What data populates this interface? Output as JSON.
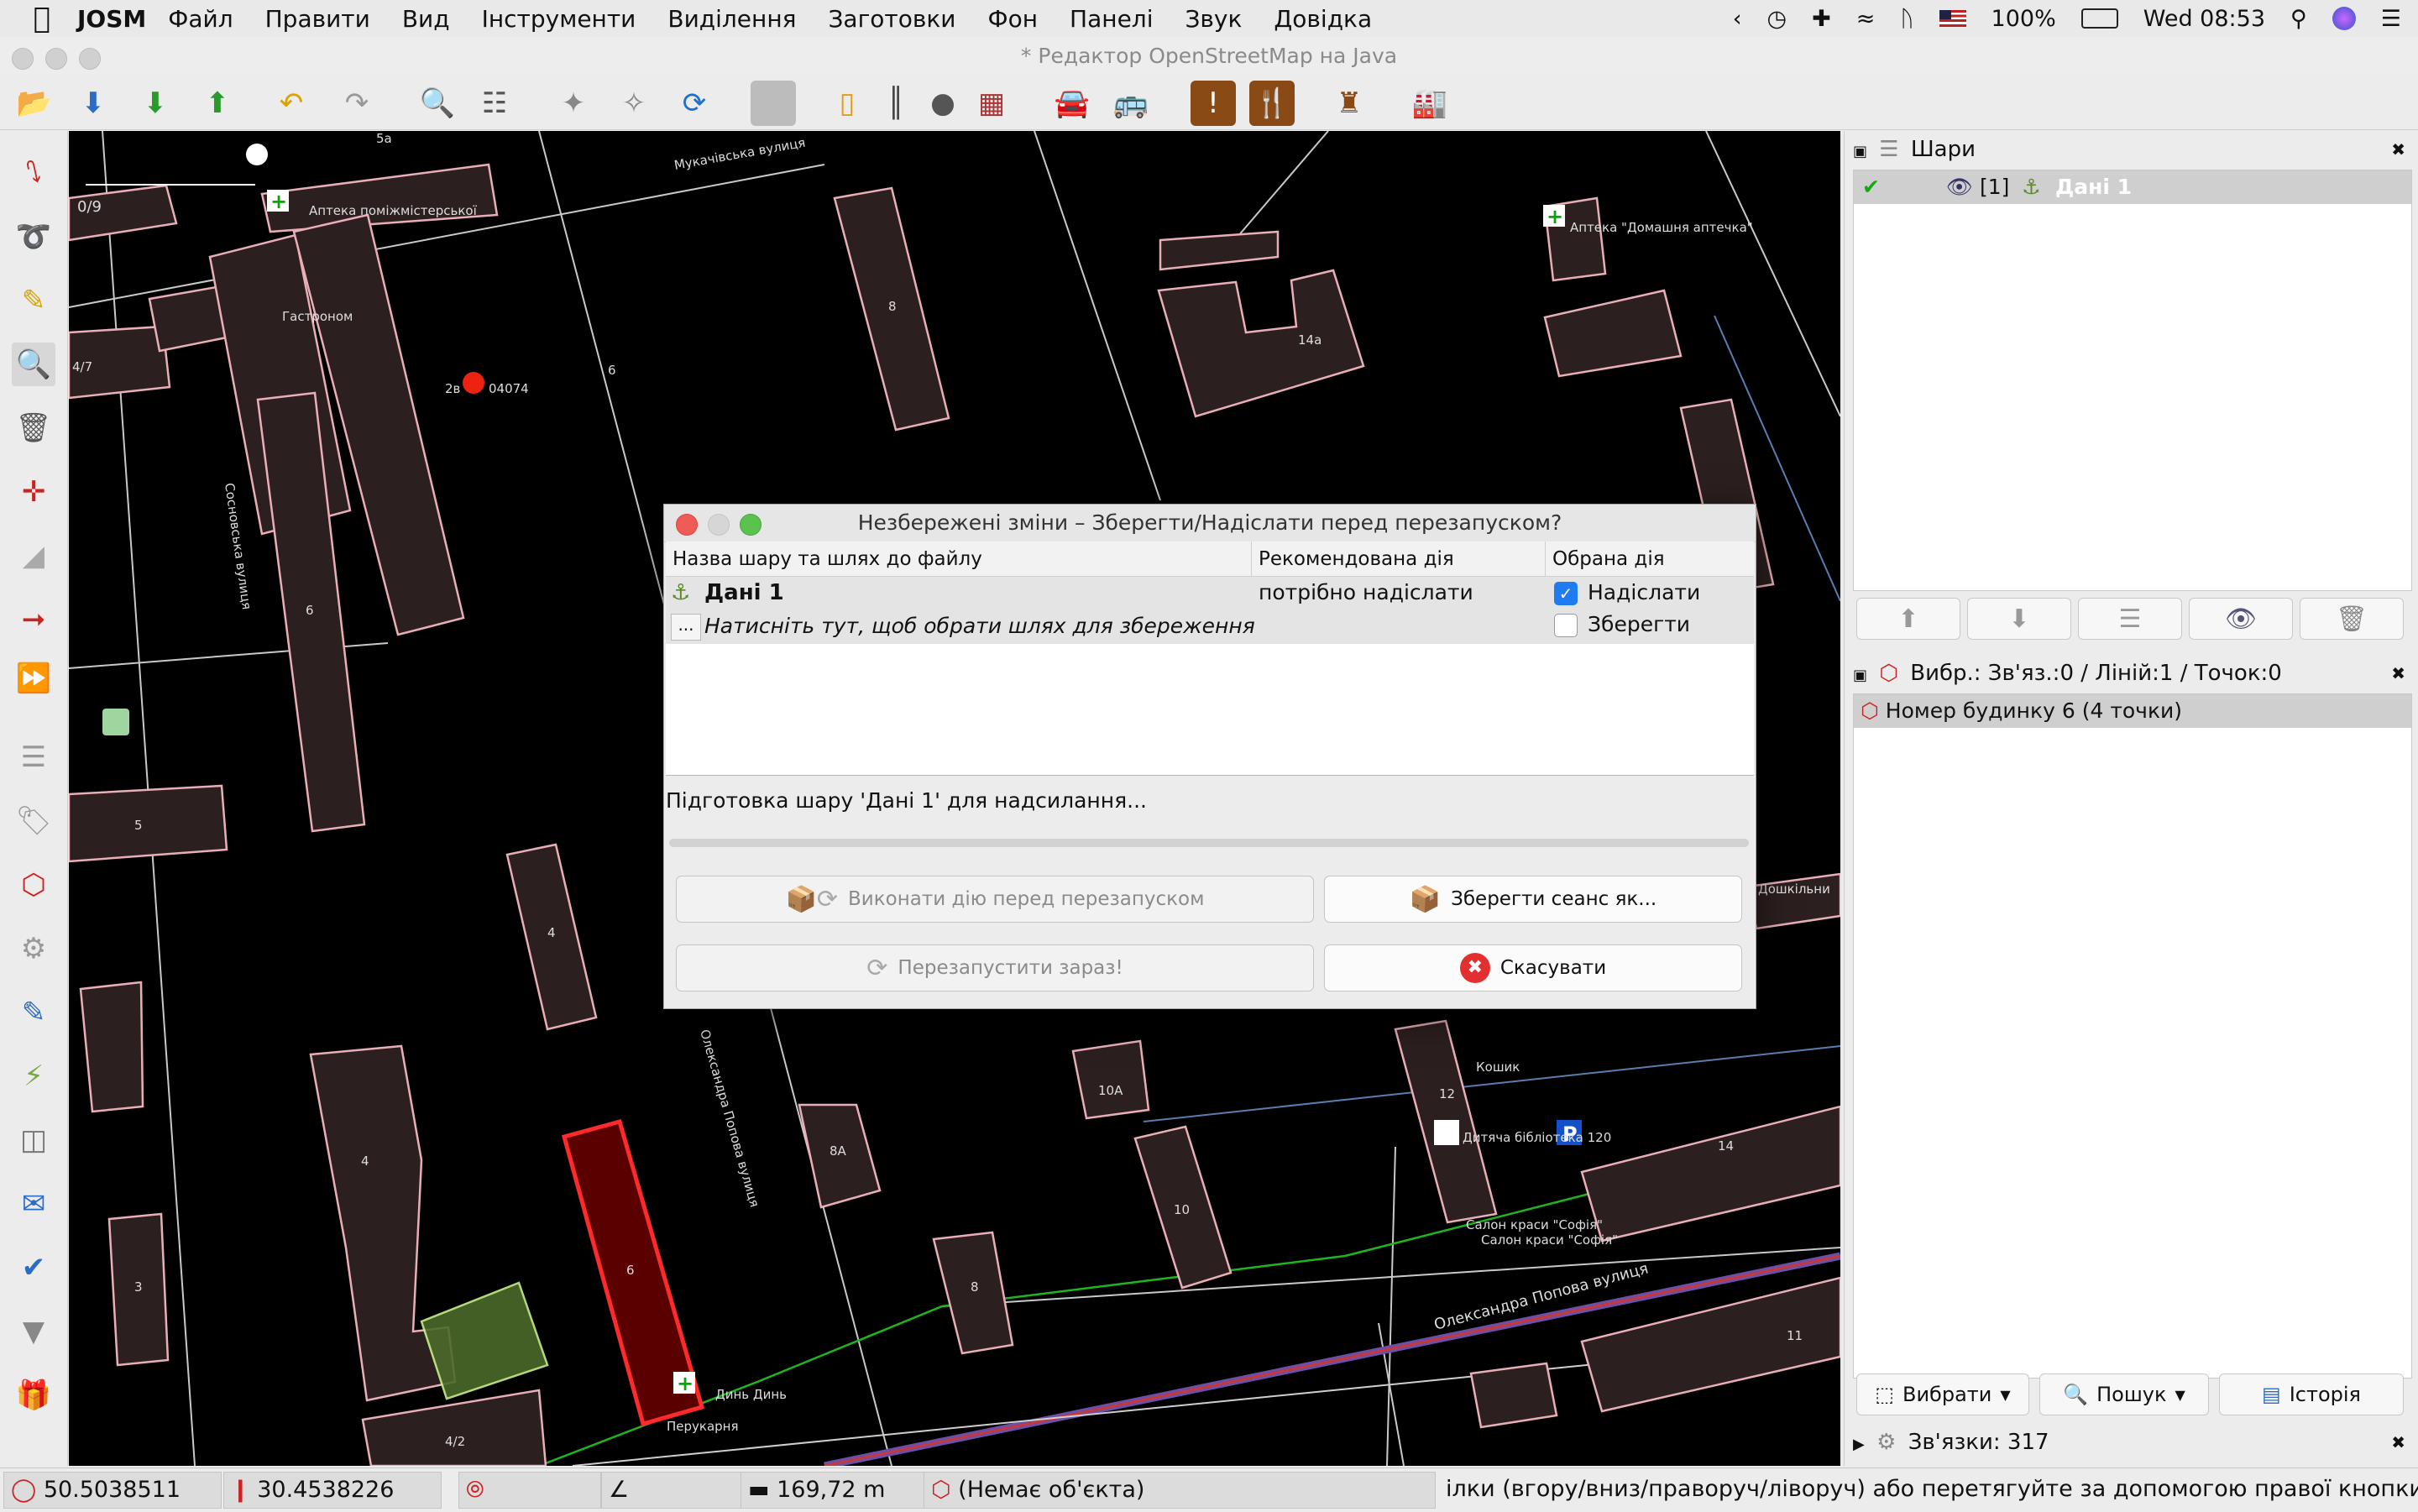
{
  "menubar": {
    "app_name": "JOSM",
    "items": [
      "Файл",
      "Правити",
      "Вид",
      "Інструменти",
      "Виділення",
      "Заготовки",
      "Фон",
      "Панелі",
      "Звук",
      "Довідка"
    ],
    "battery": "100%",
    "clock": "Wed 08:53"
  },
  "window": {
    "title": "* Редактор OpenStreetMap на Java"
  },
  "map": {
    "scale_label": "0/9",
    "labels": {
      "street_mukachivska": "Мукачівська вулиця",
      "street_sosnivska": "Сосновська вулиця",
      "street_popova_vertical": "Олександра Попова вулиця",
      "street_popova": "Олександра Попова вулиця",
      "apteka_top": "Аптека \"Домашня аптечка\"",
      "apteka_left": "Аптека поміжмістерської",
      "gastronom": "Гастроном",
      "postcode": "04074",
      "post_num": "2в",
      "din_din": "Динь Динь",
      "perukarnia": "Перукарня",
      "salon1": "Салон краси \"Софія\"",
      "salon2": "Салон краси \"Софія\"",
      "library": "Дитяча бібліотека 120",
      "koshyk": "Кошик",
      "doshkilny": "Дошкільни",
      "b_5a": "5а",
      "b_8": "8",
      "b_6": "6",
      "b_14a": "14а",
      "b_4_7": "4/7",
      "b_6b": "6",
      "b_5": "5",
      "b_4": "4",
      "b_4b": "4",
      "b_3": "3",
      "b_6sel": "6",
      "b_8a": "8А",
      "b_10a": "10А",
      "b_10": "10",
      "b_8b": "8",
      "b_12": "12",
      "b_14": "14",
      "b_11": "11",
      "b_4_2": "4/2"
    }
  },
  "layers_panel": {
    "title": "Шари",
    "layer_index": "[1]",
    "layer_name": "Дані 1"
  },
  "selection_panel": {
    "title": "Вибр.: Зв'яз.:0 / Ліній:1 / Точок:0",
    "item": "Номер будинку 6 (4 точки)",
    "btn_select": "Вибрати",
    "btn_search": "Пошук",
    "btn_history": "Історія"
  },
  "relations_panel": {
    "title": "Зв'язки: 317"
  },
  "statusbar": {
    "lat": "50.5038511",
    "lon": "30.4538226",
    "length": "169,72 m",
    "object": "(Немає об'єкта)",
    "hint": "ілки (вгору/вниз/праворуч/ліворуч) або перетягуйте за допомогою правої кнопки миші"
  },
  "dialog": {
    "title": "Незбережені зміни – Зберегти/Надіслати перед перезапуском?",
    "col_layer": "Назва шару та шлях до файлу",
    "col_recommended": "Рекомендована дія",
    "col_chosen": "Обрана дія",
    "layer_name": "Дані 1",
    "path_button": "...",
    "path_hint": "Натисніть тут, щоб обрати шлях для збереження",
    "recommended": "потрібно надіслати",
    "opt_upload": "Надіслати",
    "opt_save": "Зберегти",
    "upload_checked": true,
    "save_checked": false,
    "progress_text": "Підготовка шару 'Дані 1' для надсилання...",
    "progress_value": 0,
    "btn_perform": "Виконати дію перед перезапуском",
    "btn_save_session": "Зберегти сеанс як...",
    "btn_restart": "Перезапустити зараз!",
    "btn_cancel": "Скасувати"
  }
}
